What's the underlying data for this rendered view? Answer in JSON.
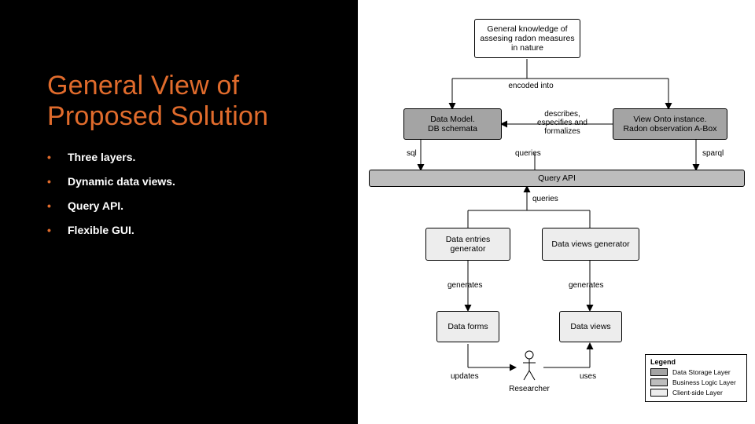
{
  "title_line1": "General View of",
  "title_line2": "Proposed Solution",
  "bullets": {
    "b1": "Three layers.",
    "b2": "Dynamic data views.",
    "b3": "Query API.",
    "b4": "Flexible GUI."
  },
  "nodes": {
    "top": "General knowledge of\nassesing radon measures\nin nature",
    "dm": "Data Model.\nDB schemata",
    "onto": "View Onto instance.\nRadon observation A-Box",
    "api": "Query API",
    "gen_e": "Data entries\ngenerator",
    "gen_v": "Data views generator",
    "forms": "Data forms",
    "views": "Data views",
    "actor": "Researcher"
  },
  "edges": {
    "encoded": "encoded into",
    "describes": "describes,\nespecifies and\nformalizes",
    "sql": "sql",
    "queries1": "queries",
    "sparql": "sparql",
    "queries2": "queries",
    "queries3": "queries",
    "gen1": "generates",
    "gen2": "generates",
    "updates": "updates",
    "uses": "uses"
  },
  "legend": {
    "title": "Legend",
    "l1": "Data Storage Layer",
    "l2": "Business Logic Layer",
    "l3": "Client-side Layer"
  }
}
